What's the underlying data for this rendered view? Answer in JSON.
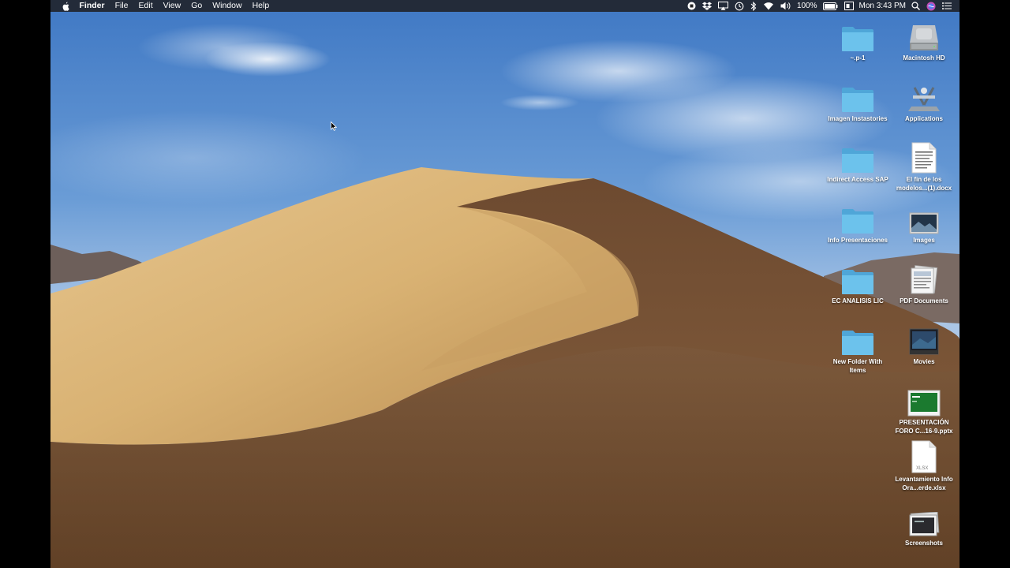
{
  "menubar": {
    "app_name": "Finder",
    "menus": [
      "File",
      "Edit",
      "View",
      "Go",
      "Window",
      "Help"
    ],
    "battery": "100%",
    "clock": "Mon 3:43 PM",
    "status_icons": [
      "screen-record-icon",
      "dropbox-icon",
      "airplay-icon",
      "time-machine-icon",
      "bluetooth-icon",
      "wifi-icon",
      "volume-icon",
      "battery-icon",
      "display-icon",
      "spotlight-icon",
      "siri-icon",
      "notification-center-icon"
    ]
  },
  "desktop": {
    "items": [
      {
        "label": "~.p-1",
        "icon": "folder-icon"
      },
      {
        "label": "Macintosh HD",
        "icon": "hard-drive-icon"
      },
      {
        "label": "Imagen Instastories",
        "icon": "folder-icon"
      },
      {
        "label": "Applications",
        "icon": "applications-icon"
      },
      {
        "label": "Indirect Access SAP",
        "icon": "folder-icon"
      },
      {
        "label": "El fin de los modelos...(1).docx",
        "icon": "document-icon"
      },
      {
        "label": "Info Presentaciones",
        "icon": "folder-icon"
      },
      {
        "label": "Images",
        "icon": "image-folder-icon"
      },
      {
        "label": "EC ANALISIS LIC",
        "icon": "folder-icon"
      },
      {
        "label": "PDF Documents",
        "icon": "pdf-stack-icon"
      },
      {
        "label": "New Folder With Items",
        "icon": "folder-icon"
      },
      {
        "label": "Movies",
        "icon": "movies-icon"
      },
      {
        "label": "PRESENTACIÓN FORO C...16-9.pptx",
        "icon": "presentation-icon"
      },
      {
        "label": "Levantamiento Info Ora...erde.xlsx",
        "icon": "spreadsheet-icon"
      },
      {
        "label": "Screenshots",
        "icon": "screenshots-icon"
      }
    ],
    "xlsx_badge": "XLSX"
  }
}
